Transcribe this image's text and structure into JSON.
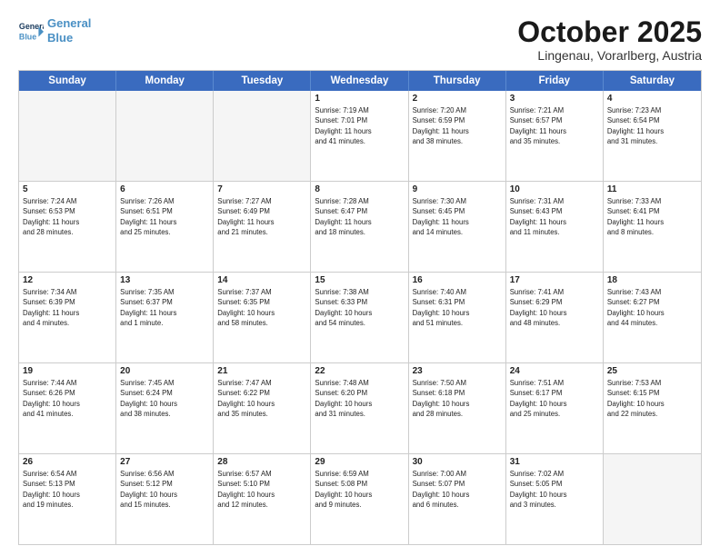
{
  "header": {
    "logo_line1": "General",
    "logo_line2": "Blue",
    "month": "October 2025",
    "location": "Lingenau, Vorarlberg, Austria"
  },
  "weekdays": [
    "Sunday",
    "Monday",
    "Tuesday",
    "Wednesday",
    "Thursday",
    "Friday",
    "Saturday"
  ],
  "rows": [
    [
      {
        "day": "",
        "info": "",
        "empty": true
      },
      {
        "day": "",
        "info": "",
        "empty": true
      },
      {
        "day": "",
        "info": "",
        "empty": true
      },
      {
        "day": "1",
        "info": "Sunrise: 7:19 AM\nSunset: 7:01 PM\nDaylight: 11 hours\nand 41 minutes.",
        "empty": false
      },
      {
        "day": "2",
        "info": "Sunrise: 7:20 AM\nSunset: 6:59 PM\nDaylight: 11 hours\nand 38 minutes.",
        "empty": false
      },
      {
        "day": "3",
        "info": "Sunrise: 7:21 AM\nSunset: 6:57 PM\nDaylight: 11 hours\nand 35 minutes.",
        "empty": false
      },
      {
        "day": "4",
        "info": "Sunrise: 7:23 AM\nSunset: 6:54 PM\nDaylight: 11 hours\nand 31 minutes.",
        "empty": false
      }
    ],
    [
      {
        "day": "5",
        "info": "Sunrise: 7:24 AM\nSunset: 6:53 PM\nDaylight: 11 hours\nand 28 minutes.",
        "empty": false
      },
      {
        "day": "6",
        "info": "Sunrise: 7:26 AM\nSunset: 6:51 PM\nDaylight: 11 hours\nand 25 minutes.",
        "empty": false
      },
      {
        "day": "7",
        "info": "Sunrise: 7:27 AM\nSunset: 6:49 PM\nDaylight: 11 hours\nand 21 minutes.",
        "empty": false
      },
      {
        "day": "8",
        "info": "Sunrise: 7:28 AM\nSunset: 6:47 PM\nDaylight: 11 hours\nand 18 minutes.",
        "empty": false
      },
      {
        "day": "9",
        "info": "Sunrise: 7:30 AM\nSunset: 6:45 PM\nDaylight: 11 hours\nand 14 minutes.",
        "empty": false
      },
      {
        "day": "10",
        "info": "Sunrise: 7:31 AM\nSunset: 6:43 PM\nDaylight: 11 hours\nand 11 minutes.",
        "empty": false
      },
      {
        "day": "11",
        "info": "Sunrise: 7:33 AM\nSunset: 6:41 PM\nDaylight: 11 hours\nand 8 minutes.",
        "empty": false
      }
    ],
    [
      {
        "day": "12",
        "info": "Sunrise: 7:34 AM\nSunset: 6:39 PM\nDaylight: 11 hours\nand 4 minutes.",
        "empty": false
      },
      {
        "day": "13",
        "info": "Sunrise: 7:35 AM\nSunset: 6:37 PM\nDaylight: 11 hours\nand 1 minute.",
        "empty": false
      },
      {
        "day": "14",
        "info": "Sunrise: 7:37 AM\nSunset: 6:35 PM\nDaylight: 10 hours\nand 58 minutes.",
        "empty": false
      },
      {
        "day": "15",
        "info": "Sunrise: 7:38 AM\nSunset: 6:33 PM\nDaylight: 10 hours\nand 54 minutes.",
        "empty": false
      },
      {
        "day": "16",
        "info": "Sunrise: 7:40 AM\nSunset: 6:31 PM\nDaylight: 10 hours\nand 51 minutes.",
        "empty": false
      },
      {
        "day": "17",
        "info": "Sunrise: 7:41 AM\nSunset: 6:29 PM\nDaylight: 10 hours\nand 48 minutes.",
        "empty": false
      },
      {
        "day": "18",
        "info": "Sunrise: 7:43 AM\nSunset: 6:27 PM\nDaylight: 10 hours\nand 44 minutes.",
        "empty": false
      }
    ],
    [
      {
        "day": "19",
        "info": "Sunrise: 7:44 AM\nSunset: 6:26 PM\nDaylight: 10 hours\nand 41 minutes.",
        "empty": false
      },
      {
        "day": "20",
        "info": "Sunrise: 7:45 AM\nSunset: 6:24 PM\nDaylight: 10 hours\nand 38 minutes.",
        "empty": false
      },
      {
        "day": "21",
        "info": "Sunrise: 7:47 AM\nSunset: 6:22 PM\nDaylight: 10 hours\nand 35 minutes.",
        "empty": false
      },
      {
        "day": "22",
        "info": "Sunrise: 7:48 AM\nSunset: 6:20 PM\nDaylight: 10 hours\nand 31 minutes.",
        "empty": false
      },
      {
        "day": "23",
        "info": "Sunrise: 7:50 AM\nSunset: 6:18 PM\nDaylight: 10 hours\nand 28 minutes.",
        "empty": false
      },
      {
        "day": "24",
        "info": "Sunrise: 7:51 AM\nSunset: 6:17 PM\nDaylight: 10 hours\nand 25 minutes.",
        "empty": false
      },
      {
        "day": "25",
        "info": "Sunrise: 7:53 AM\nSunset: 6:15 PM\nDaylight: 10 hours\nand 22 minutes.",
        "empty": false
      }
    ],
    [
      {
        "day": "26",
        "info": "Sunrise: 6:54 AM\nSunset: 5:13 PM\nDaylight: 10 hours\nand 19 minutes.",
        "empty": false
      },
      {
        "day": "27",
        "info": "Sunrise: 6:56 AM\nSunset: 5:12 PM\nDaylight: 10 hours\nand 15 minutes.",
        "empty": false
      },
      {
        "day": "28",
        "info": "Sunrise: 6:57 AM\nSunset: 5:10 PM\nDaylight: 10 hours\nand 12 minutes.",
        "empty": false
      },
      {
        "day": "29",
        "info": "Sunrise: 6:59 AM\nSunset: 5:08 PM\nDaylight: 10 hours\nand 9 minutes.",
        "empty": false
      },
      {
        "day": "30",
        "info": "Sunrise: 7:00 AM\nSunset: 5:07 PM\nDaylight: 10 hours\nand 6 minutes.",
        "empty": false
      },
      {
        "day": "31",
        "info": "Sunrise: 7:02 AM\nSunset: 5:05 PM\nDaylight: 10 hours\nand 3 minutes.",
        "empty": false
      },
      {
        "day": "",
        "info": "",
        "empty": true
      }
    ]
  ]
}
